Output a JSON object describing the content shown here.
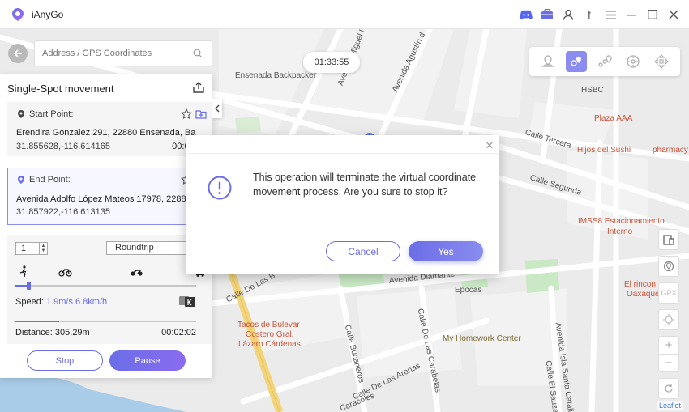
{
  "app": {
    "name": "iAnyGo"
  },
  "titlebar": {
    "icons": [
      "discord-icon",
      "toolbox-icon",
      "user-icon",
      "facebook-icon",
      "menu-icon",
      "minimize-icon",
      "maximize-icon",
      "close-icon"
    ],
    "facebook_glyph": "f"
  },
  "search": {
    "placeholder": "Address / GPS Coordinates"
  },
  "timer": "01:33:55",
  "panel": {
    "title": "Single-Spot movement",
    "start": {
      "label": "Start Point:",
      "address": "Erendira Gonzalez 291, 22880 Ensenada, Ba",
      "coords": "31.855628,-116.614165",
      "time": "00:00:00"
    },
    "end": {
      "label": "End Point:",
      "address": "Avenida Adolfo López Mateos 17978, 2288",
      "coords": "31.857922,-116.613135"
    },
    "count": "1",
    "mode": "Roundtrip",
    "speed_label": "Speed:",
    "speed_value": "1.9m/s 6.8km/h",
    "speed_fraction": 0.07,
    "progress_fraction": 0.24,
    "distance": "Distance: 305.29m",
    "eta": "00:02:02",
    "stop_label": "Stop",
    "pause_label": "Pause"
  },
  "dialog": {
    "message": "This operation will terminate the virtual coordinate movement process. Are you sure to stop it?",
    "cancel_label": "Cancel",
    "yes_label": "Yes"
  },
  "map": {
    "labels": {
      "backpacker": "Ensenada Backpacker",
      "hsbc": "HSBC",
      "plaza": "Plaza AAA",
      "sushi": "Hijos del Sushi",
      "pharmacy": "pharmacy",
      "imss": "IMSS8 Estacionamiento",
      "imss2": "Interno",
      "rincon": "El rincon",
      "oaxaque": "Oaxaque",
      "epocas": "Epocas",
      "homework": "My Homework Center",
      "tacos1": "Tacos de Bulevar",
      "tacos2": "Costero Gral.",
      "tacos3": "Lázaro Cárdenas"
    },
    "streets": {
      "tercera": "Calle Tercera",
      "segunda": "Calle Segunda",
      "diamante": "Avenida Diamante",
      "miguel": "Avenida Miguel Hid",
      "agustin": "Avenida Agustín d",
      "lasb": "Calle De Las B",
      "bucaneros": "Calle Bucaneros",
      "carabelas": "Calle De Las Carabelas",
      "arenas": "Calle De Las Arenas",
      "isla": "Avenida Isla Santa Catalina",
      "sauzal": "Calle El Sauzal",
      "caracoles": "Caracoles"
    },
    "attribution": "Leaflet"
  },
  "controls": {
    "gpx": "GPX",
    "zoom_in": "+",
    "zoom_out": "−"
  },
  "colors": {
    "accent": "#6b6de6",
    "poi": "#c7543a"
  }
}
